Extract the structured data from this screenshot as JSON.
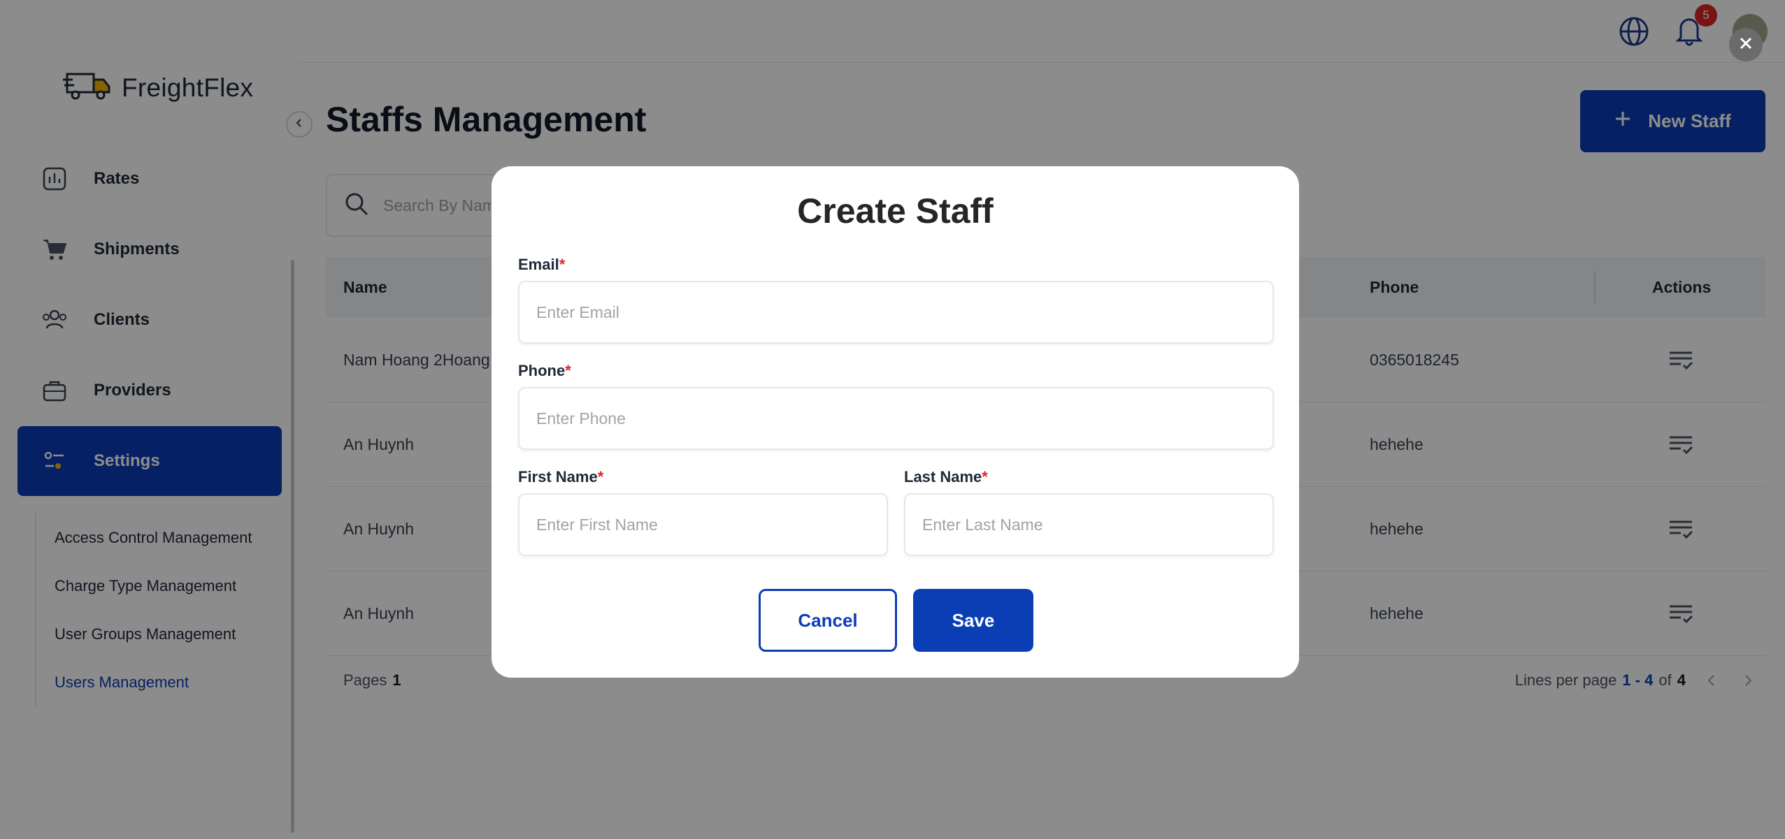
{
  "app": {
    "brand": "FreightFlex"
  },
  "sidebar": {
    "items": [
      {
        "label": "Rates",
        "icon": "chart-icon"
      },
      {
        "label": "Shipments",
        "icon": "cart-icon"
      },
      {
        "label": "Clients",
        "icon": "users-icon"
      },
      {
        "label": "Providers",
        "icon": "briefcase-icon"
      },
      {
        "label": "Settings",
        "icon": "settings-icon",
        "active": true
      }
    ],
    "submenu": [
      {
        "label": "Access Control Management"
      },
      {
        "label": "Charge Type Management"
      },
      {
        "label": "User Groups Management"
      },
      {
        "label": "Users Management",
        "active": true
      }
    ]
  },
  "topbar": {
    "notification_count": "5"
  },
  "main": {
    "title": "Staffs Management",
    "new_button": "New Staff",
    "search_placeholder": "Search By Name",
    "columns": {
      "name": "Name",
      "phone": "Phone",
      "actions": "Actions"
    },
    "rows": [
      {
        "name": "Nam Hoang 2Hoang",
        "phone": "0365018245"
      },
      {
        "name": "An Huynh",
        "phone": "hehehe"
      },
      {
        "name": "An Huynh",
        "phone": "hehehe"
      },
      {
        "name": "An Huynh",
        "phone": "hehehe"
      }
    ],
    "footer": {
      "pages_label": "Pages",
      "pages_value": "1",
      "lines_label": "Lines per page",
      "range": "1 - 4",
      "of": "of",
      "total": "4"
    }
  },
  "modal": {
    "title": "Create Staff",
    "required_mark": "*",
    "email": {
      "label": "Email",
      "placeholder": "Enter Email"
    },
    "phone": {
      "label": "Phone",
      "placeholder": "Enter Phone"
    },
    "first_name": {
      "label": "First Name",
      "placeholder": "Enter First Name"
    },
    "last_name": {
      "label": "Last Name",
      "placeholder": "Enter Last Name"
    },
    "cancel": "Cancel",
    "save": "Save"
  },
  "colors": {
    "primary": "#0b3db5",
    "danger": "#dc2626"
  }
}
